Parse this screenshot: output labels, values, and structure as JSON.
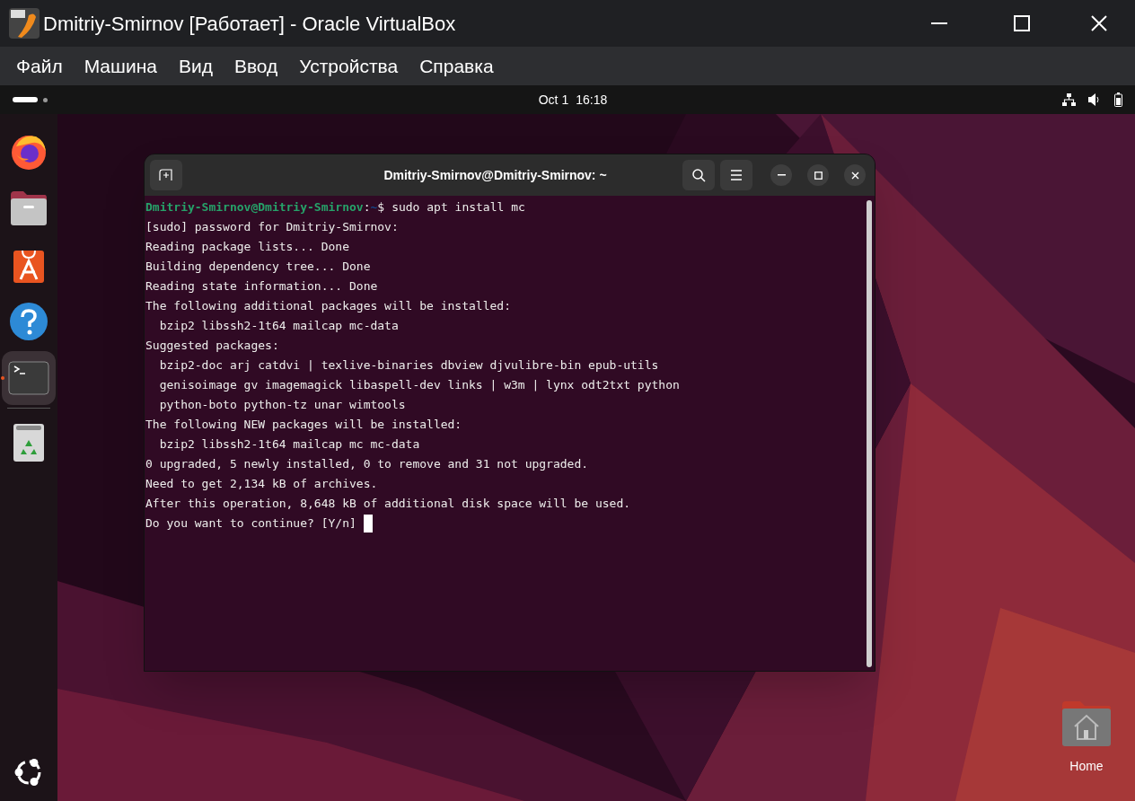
{
  "window": {
    "title": "Dmitriy-Smirnov [Работает] - Oracle VirtualBox"
  },
  "menu": [
    "Файл",
    "Машина",
    "Вид",
    "Ввод",
    "Устройства",
    "Справка"
  ],
  "top_bar": {
    "date": "Oct 1",
    "time": "16:18"
  },
  "dock": {
    "items": [
      {
        "kind": "browser",
        "selected": false,
        "running": false
      },
      {
        "kind": "files",
        "selected": false,
        "running": false
      },
      {
        "kind": "store",
        "selected": false,
        "running": false
      },
      {
        "kind": "help",
        "selected": false,
        "running": false
      },
      {
        "kind": "terminal",
        "selected": true,
        "running": true
      },
      {
        "kind": "trash",
        "selected": false,
        "running": false
      }
    ]
  },
  "terminal": {
    "title": "Dmitriy-Smirnov@Dmitriy-Smirnov: ~",
    "lines": [
      {
        "kind": "prompt",
        "user": "Dmitriy-Smirnov@Dmitriy-Smirnov",
        "separator": ":",
        "path": "~",
        "symbol": "$",
        "text": "sudo apt install mc"
      },
      {
        "kind": "output",
        "text": "[sudo] password for Dmitriy-Smirnov:"
      },
      {
        "kind": "output",
        "text": "Reading package lists... Done"
      },
      {
        "kind": "output",
        "text": "Building dependency tree... Done"
      },
      {
        "kind": "output",
        "text": "Reading state information... Done"
      },
      {
        "kind": "output",
        "text": "The following additional packages will be installed:"
      },
      {
        "kind": "output",
        "text": "  bzip2 libssh2-1t64 mailcap mc-data"
      },
      {
        "kind": "output",
        "text": "Suggested packages:"
      },
      {
        "kind": "output",
        "text": "  bzip2-doc arj catdvi | texlive-binaries dbview djvulibre-bin epub-utils"
      },
      {
        "kind": "output",
        "text": "  genisoimage gv imagemagick libaspell-dev links | w3m | lynx odt2txt python"
      },
      {
        "kind": "output",
        "text": "  python-boto python-tz unar wimtools"
      },
      {
        "kind": "output",
        "text": "The following NEW packages will be installed:"
      },
      {
        "kind": "output",
        "text": "  bzip2 libssh2-1t64 mailcap mc mc-data"
      },
      {
        "kind": "output",
        "text": "0 upgraded, 5 newly installed, 0 to remove and 31 not upgraded."
      },
      {
        "kind": "output",
        "text": "Need to get 2,134 kB of archives."
      },
      {
        "kind": "output",
        "text": "After this operation, 8,648 kB of additional disk space will be used."
      },
      {
        "kind": "output",
        "text": "Do you want to continue? [Y/n]",
        "cursor": true
      }
    ]
  },
  "desktop_icons": [
    {
      "label": "Home"
    }
  ]
}
